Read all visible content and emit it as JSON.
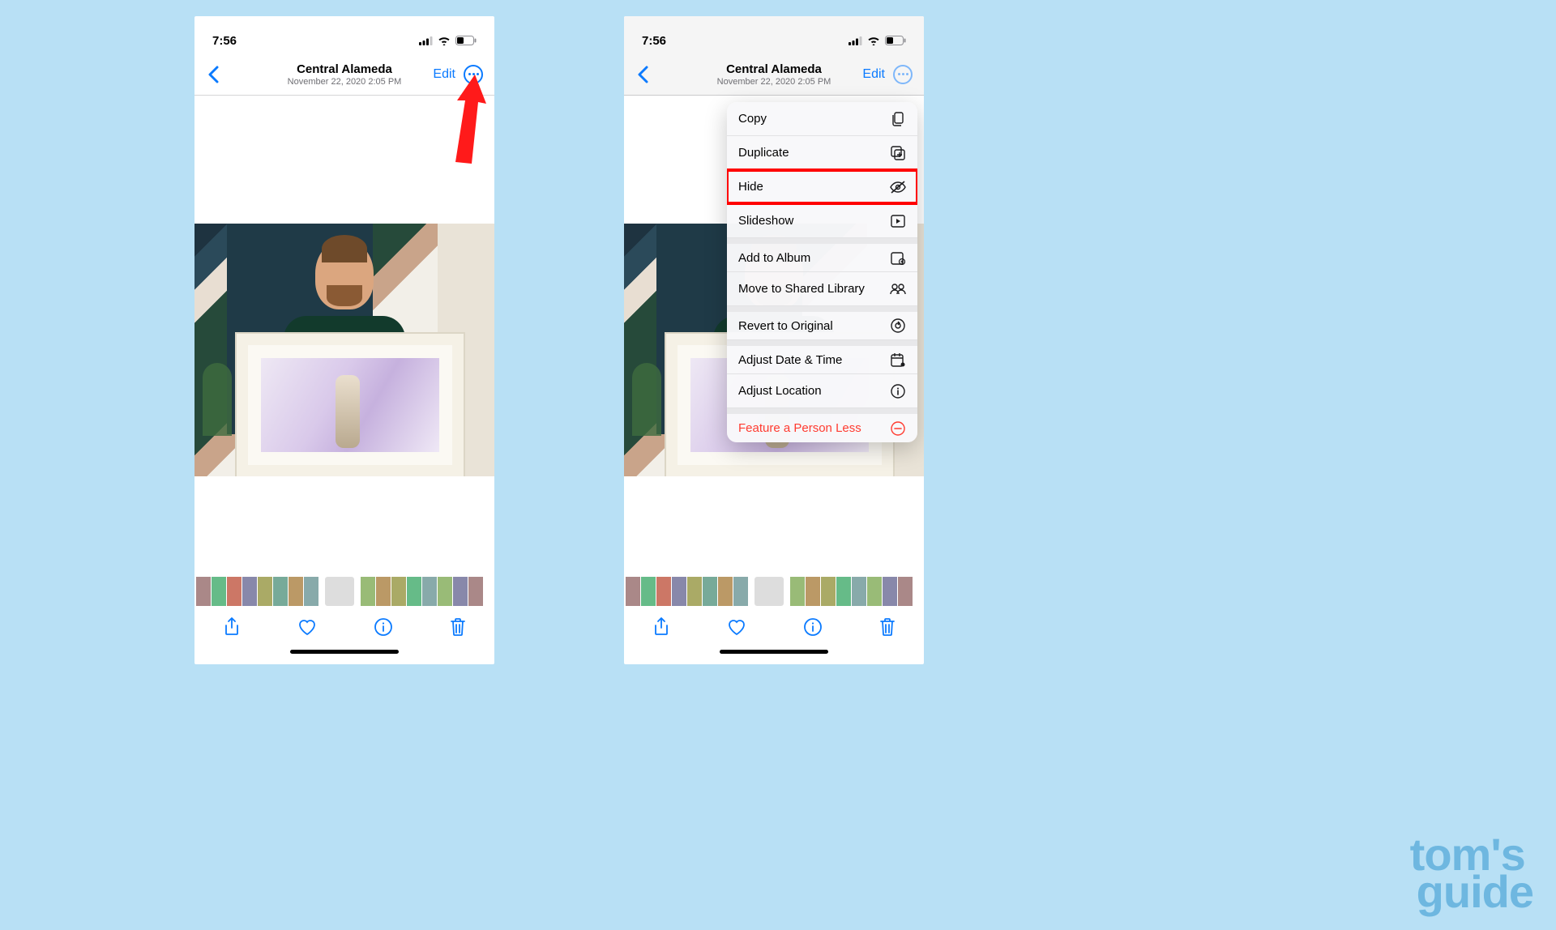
{
  "statusTime": "7:56",
  "header": {
    "title": "Central Alameda",
    "subtitle": "November 22, 2020  2:05 PM",
    "editLabel": "Edit"
  },
  "menu": {
    "items": [
      {
        "key": "copy",
        "label": "Copy",
        "icon": "copy"
      },
      {
        "key": "duplicate",
        "label": "Duplicate",
        "icon": "duplicate"
      },
      {
        "key": "hide",
        "label": "Hide",
        "icon": "eye-slash",
        "highlighted": true
      },
      {
        "key": "slideshow",
        "label": "Slideshow",
        "icon": "play-rect"
      },
      {
        "key": "add-album",
        "label": "Add to Album",
        "icon": "album-add",
        "gap": true
      },
      {
        "key": "move-shared",
        "label": "Move to Shared Library",
        "icon": "people"
      },
      {
        "key": "revert",
        "label": "Revert to Original",
        "icon": "revert",
        "gap": true
      },
      {
        "key": "adjust-datetime",
        "label": "Adjust Date & Time",
        "icon": "calendar",
        "gap": true
      },
      {
        "key": "adjust-location",
        "label": "Adjust Location",
        "icon": "info"
      },
      {
        "key": "feature-less",
        "label": "Feature a Person Less",
        "icon": "minus-circle",
        "gap": true,
        "danger": true
      }
    ]
  },
  "watermark": {
    "line1": "tom's",
    "line2": "guide"
  }
}
